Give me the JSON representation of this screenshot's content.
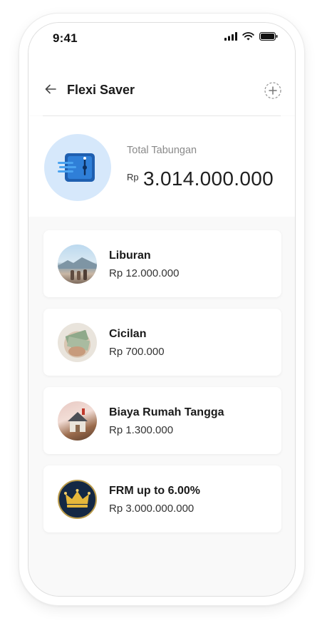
{
  "status": {
    "time": "9:41"
  },
  "header": {
    "title": "Flexi Saver"
  },
  "summary": {
    "label": "Total Tabungan",
    "currency": "Rp",
    "amount": "3.014.000.000"
  },
  "pockets": [
    {
      "name": "Liburan",
      "amount": "Rp 12.000.000",
      "icon": "beach-photo"
    },
    {
      "name": "Cicilan",
      "amount": "Rp 700.000",
      "icon": "money-photo"
    },
    {
      "name": "Biaya Rumah Tangga",
      "amount": "Rp 1.300.000",
      "icon": "house-photo"
    },
    {
      "name": "FRM up to 6.00%",
      "amount": "Rp 3.000.000.000",
      "icon": "crown-icon"
    }
  ],
  "colors": {
    "accent": "#1f6fd0",
    "avatar_bg": "#d6e8fb",
    "crown_gold": "#e5b73b",
    "crown_bg": "#142844"
  }
}
